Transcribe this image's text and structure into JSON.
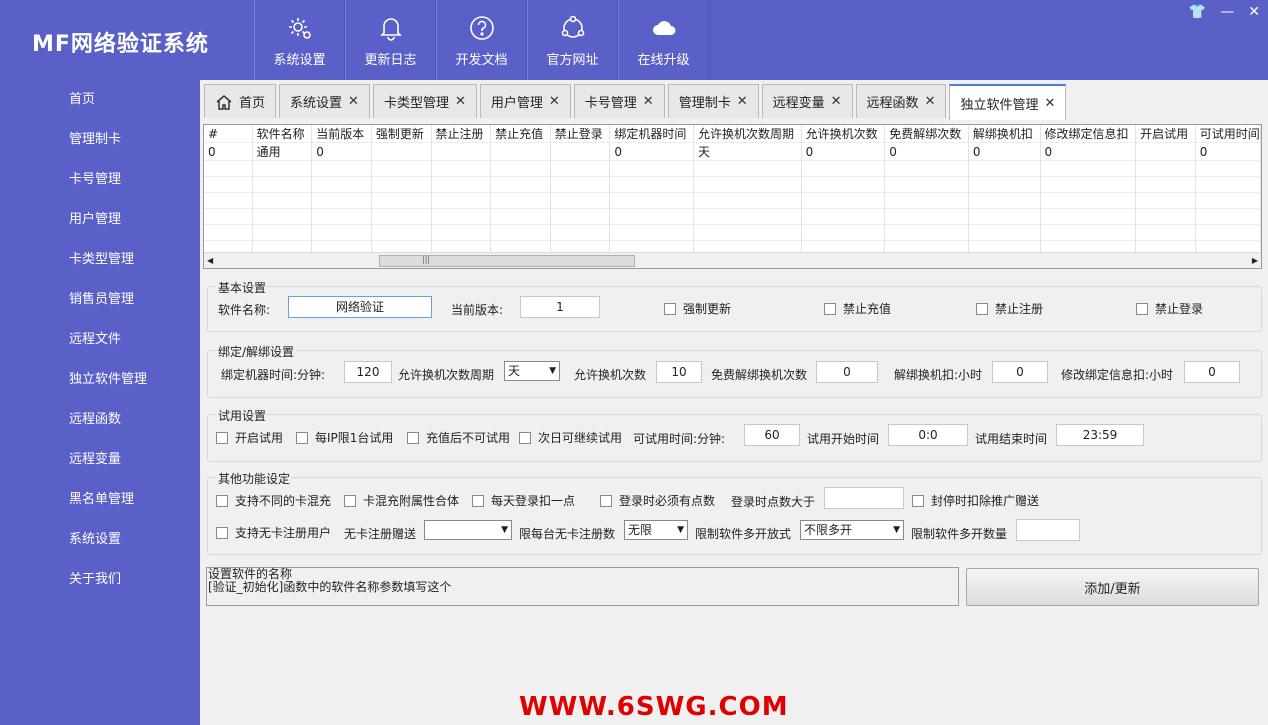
{
  "app": {
    "title": "MF网络验证系统"
  },
  "toolbar": [
    {
      "label": "系统设置",
      "icon": "settings-icon"
    },
    {
      "label": "更新日志",
      "icon": "bell-icon"
    },
    {
      "label": "开发文档",
      "icon": "help-icon"
    },
    {
      "label": "官方网址",
      "icon": "network-icon"
    },
    {
      "label": "在线升级",
      "icon": "cloud-icon"
    }
  ],
  "window_controls": {
    "skin": "👕",
    "minimize": "—",
    "close": "✕"
  },
  "sidebar": {
    "items": [
      "首页",
      "管理制卡",
      "卡号管理",
      "用户管理",
      "卡类型管理",
      "销售员管理",
      "远程文件",
      "独立软件管理",
      "远程函数",
      "远程变量",
      "黑名单管理",
      "系统设置",
      "关于我们"
    ]
  },
  "tabs": [
    {
      "label": "首页",
      "closable": false
    },
    {
      "label": "系统设置",
      "closable": true
    },
    {
      "label": "卡类型管理",
      "closable": true
    },
    {
      "label": "用户管理",
      "closable": true
    },
    {
      "label": "卡号管理",
      "closable": true
    },
    {
      "label": "管理制卡",
      "closable": true
    },
    {
      "label": "远程变量",
      "closable": true
    },
    {
      "label": "远程函数",
      "closable": true
    },
    {
      "label": "独立软件管理",
      "closable": true,
      "active": true
    }
  ],
  "grid": {
    "columns": [
      "#",
      "软件名称",
      "当前版本",
      "强制更新",
      "禁止注册",
      "禁止充值",
      "禁止登录",
      "绑定机器时间",
      "允许换机次数周期",
      "允许换机次数",
      "免费解绑次数",
      "解绑换机扣",
      "修改绑定信息扣",
      "开启试用",
      "可试用时间"
    ],
    "rows": [
      [
        "0",
        "通用",
        "0",
        "",
        "",
        "",
        "",
        "0",
        "天",
        "0",
        "0",
        "0",
        "0",
        "",
        "0"
      ]
    ]
  },
  "basic": {
    "legend": "基本设置",
    "name_label": "软件名称:",
    "name_value": "网络验证",
    "version_label": "当前版本:",
    "version_value": "1",
    "force_update": "强制更新",
    "no_recharge": "禁止充值",
    "no_register": "禁止注册",
    "no_login": "禁止登录"
  },
  "bind": {
    "legend": "绑定/解绑设置",
    "bind_time_label": "绑定机器时间:分钟:",
    "bind_time_value": "120",
    "cycle_label": "允许换机次数周期",
    "cycle_value": "天",
    "times_label": "允许换机次数",
    "times_value": "10",
    "free_label": "免费解绑换机次数",
    "free_value": "0",
    "deduct_label": "解绑换机扣:小时",
    "deduct_value": "0",
    "modify_label": "修改绑定信息扣:小时",
    "modify_value": "0"
  },
  "trial": {
    "legend": "试用设置",
    "enable": "开启试用",
    "per_ip": "每IP限1台试用",
    "no_after_recharge": "充值后不可试用",
    "next_day": "次日可继续试用",
    "time_label": "可试用时间:分钟:",
    "time_value": "60",
    "start_label": "试用开始时间",
    "start_value": "0:0",
    "end_label": "试用结束时间",
    "end_value": "23:59"
  },
  "other": {
    "legend": "其他功能设定",
    "mix_cards": "支持不同的卡混充",
    "mix_attr": "卡混充附属性合体",
    "daily_deduct": "每天登录扣一点",
    "need_points": "登录时必须有点数",
    "points_label": "登录时点数大于",
    "points_value": "",
    "freeze": "封停时扣除推广赠送",
    "no_card_reg": "支持无卡注册用户",
    "gift_label": "无卡注册赠送",
    "gift_value": "",
    "limit_label": "限每台无卡注册数",
    "limit_value": "无限",
    "multi_label": "限制软件多开放式",
    "multi_value": "不限多开",
    "multi_count_label": "限制软件多开数量",
    "multi_count_value": ""
  },
  "hint": {
    "line1": "设置软件的名称",
    "line2": "[验证_初始化]函数中的软件名称参数填写这个"
  },
  "submit": {
    "label": "添加/更新"
  },
  "watermark": "WWW.6SWG.COM"
}
